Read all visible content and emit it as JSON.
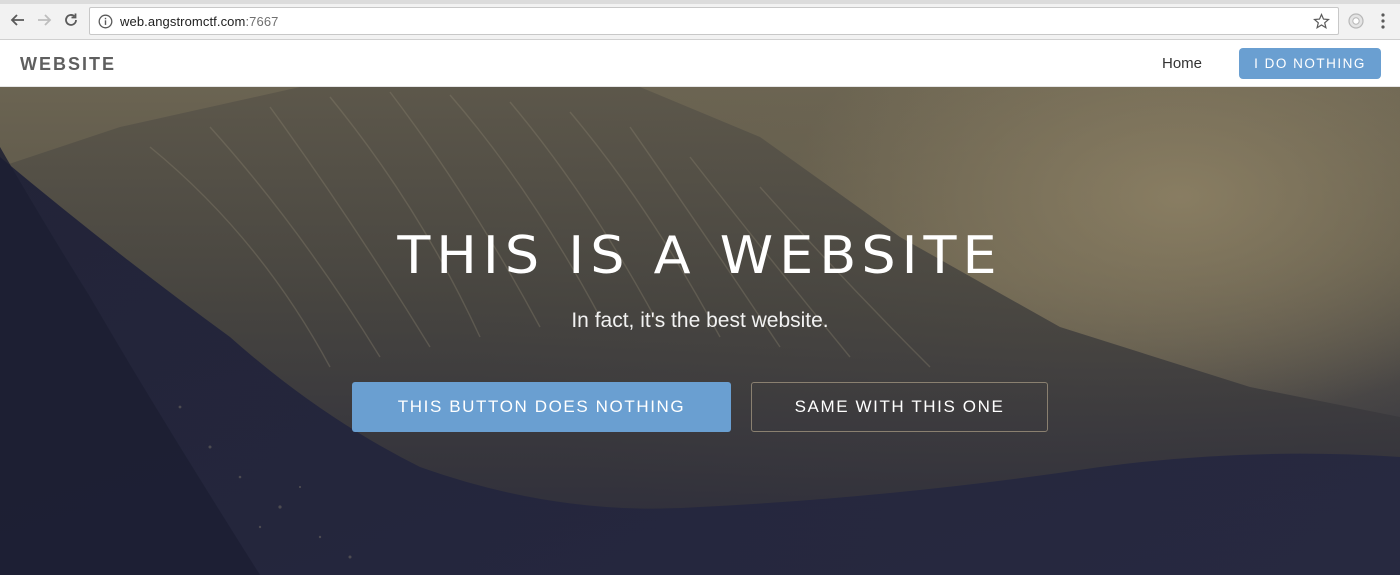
{
  "browser": {
    "url_host": "web.angstromctf.com",
    "url_port": ":7667"
  },
  "navbar": {
    "brand": "WEBSITE",
    "home_link": "Home",
    "cta_button": "I DO NOTHING"
  },
  "hero": {
    "title": "THIS IS A WEBSITE",
    "subtitle": "In fact, it's the best website.",
    "primary_button": "THIS BUTTON DOES NOTHING",
    "secondary_button": "SAME WITH THIS ONE"
  },
  "colors": {
    "accent": "#6a9fd1",
    "brand_text": "#5f5f5f"
  },
  "icons": {
    "back": "back-arrow-icon",
    "forward": "forward-arrow-icon",
    "reload": "reload-icon",
    "site_info": "info-icon",
    "bookmark": "star-icon",
    "extension": "extension-icon",
    "menu": "kebab-menu-icon"
  }
}
